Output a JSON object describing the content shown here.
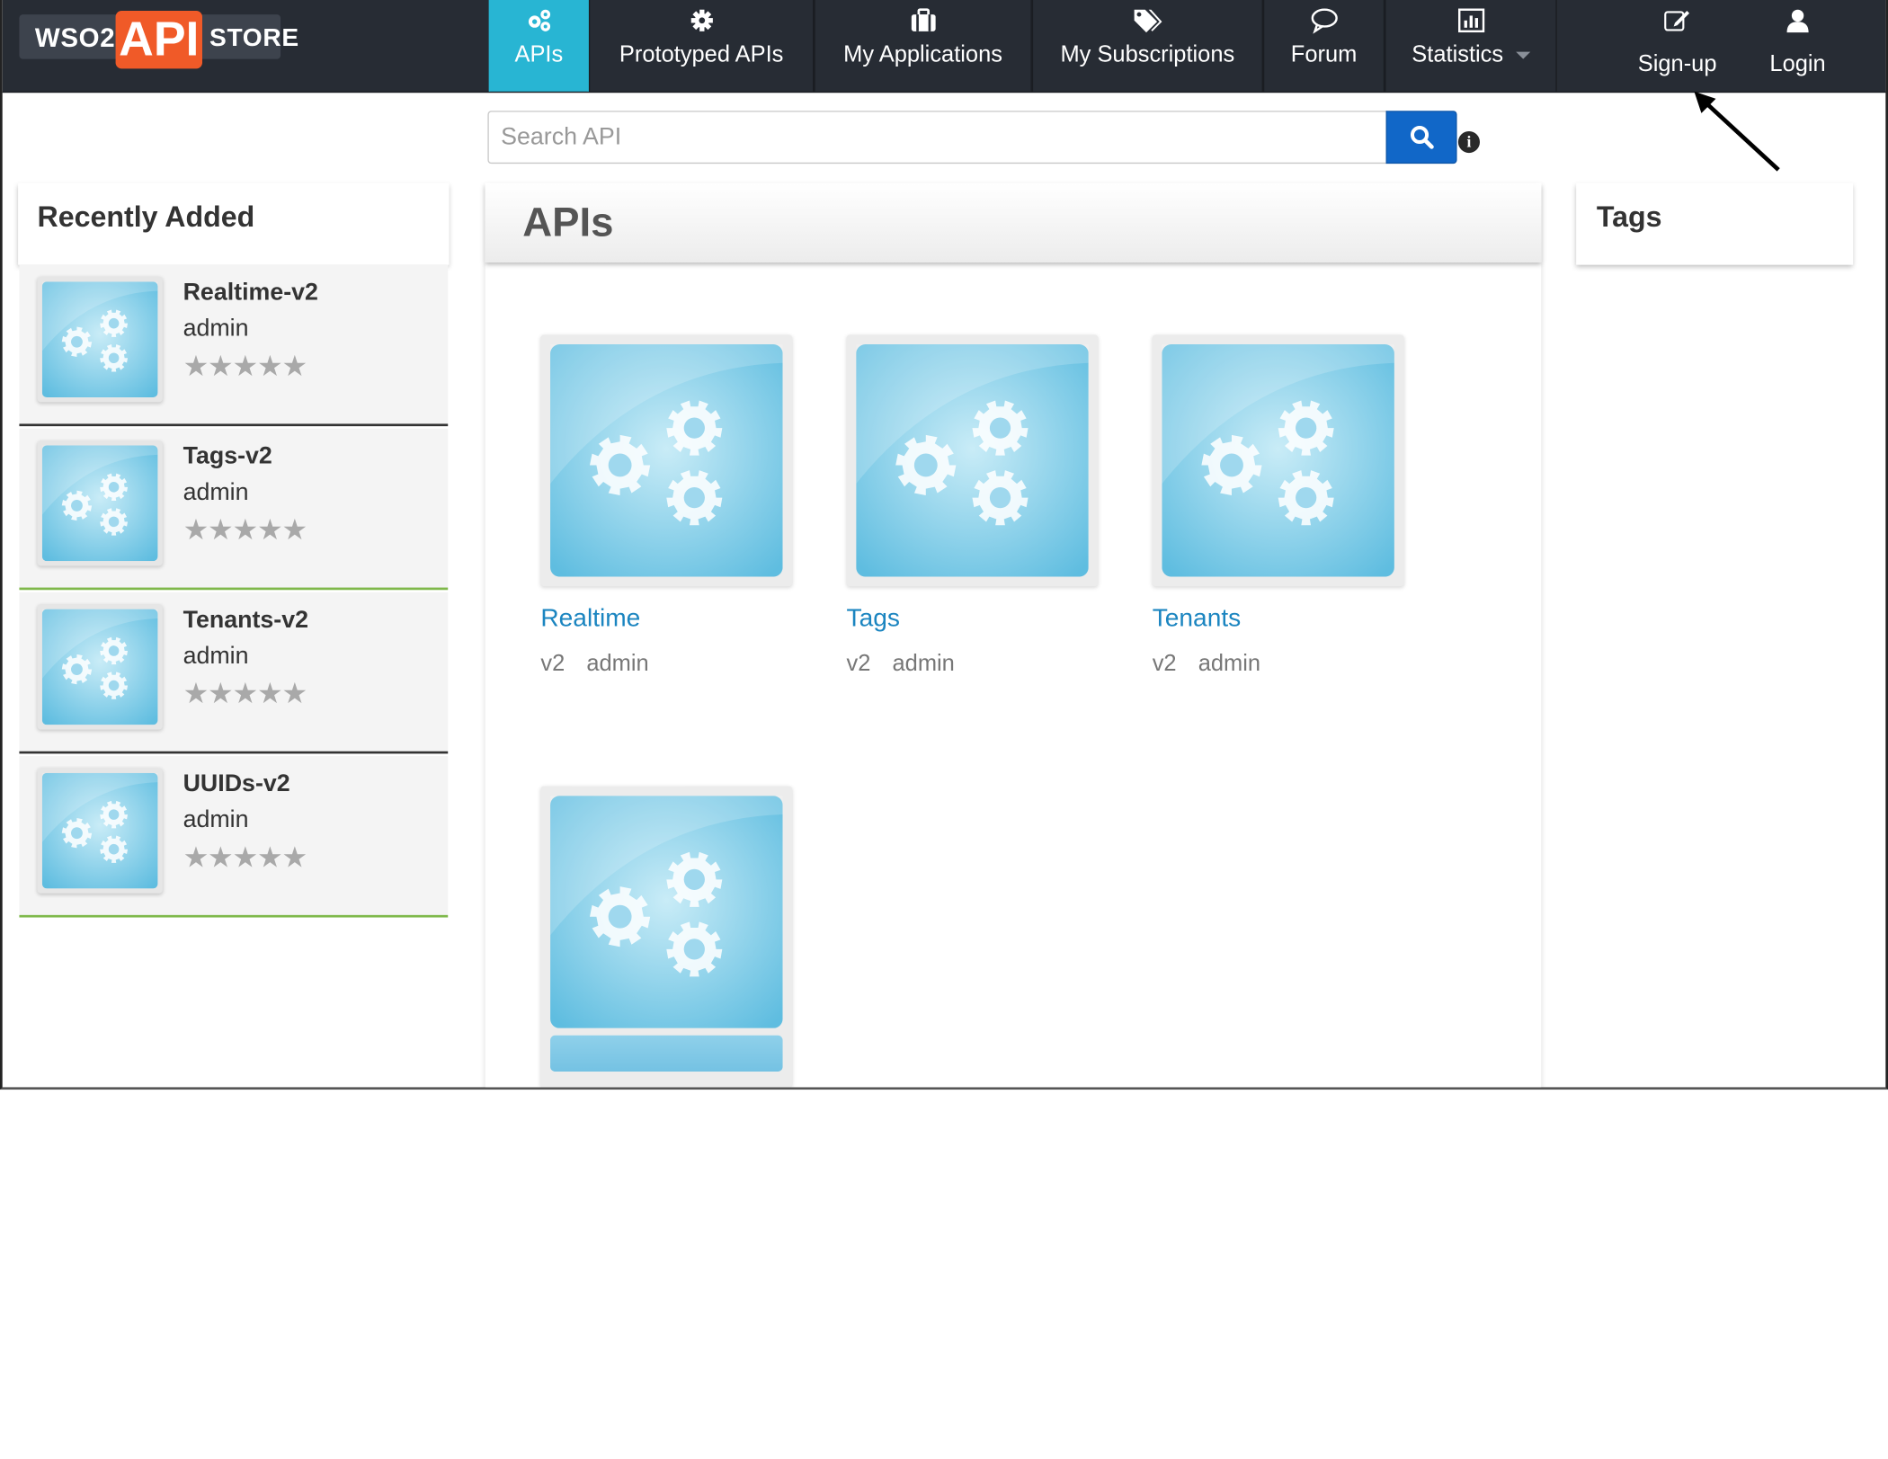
{
  "brand": {
    "wso2": "WSO2",
    "api": "API",
    "store": "STORE"
  },
  "nav": {
    "items": [
      {
        "label": "APIs",
        "icon": "cogs-icon",
        "active": true
      },
      {
        "label": "Prototyped APIs",
        "icon": "gear-icon"
      },
      {
        "label": "My Applications",
        "icon": "briefcase-icon"
      },
      {
        "label": "My Subscriptions",
        "icon": "tags-icon"
      },
      {
        "label": "Forum",
        "icon": "speech-bubble-icon"
      },
      {
        "label": "Statistics",
        "icon": "bar-chart-icon",
        "has_dropdown": true
      }
    ],
    "signup": {
      "label": "Sign-up",
      "icon": "edit-icon"
    },
    "login": {
      "label": "Login",
      "icon": "user-icon"
    }
  },
  "search": {
    "placeholder": "Search API",
    "button_icon": "search-icon",
    "info_icon": "info-icon"
  },
  "recently_added": {
    "title": "Recently Added",
    "items": [
      {
        "name": "Realtime-v2",
        "owner": "admin",
        "rating": 0,
        "stars": "★★★★★"
      },
      {
        "name": "Tags-v2",
        "owner": "admin",
        "rating": 0,
        "stars": "★★★★★"
      },
      {
        "name": "Tenants-v2",
        "owner": "admin",
        "rating": 0,
        "stars": "★★★★★"
      },
      {
        "name": "UUIDs-v2",
        "owner": "admin",
        "rating": 0,
        "stars": "★★★★★"
      }
    ]
  },
  "apis": {
    "title": "APIs",
    "cards": [
      {
        "name": "Realtime",
        "version": "v2",
        "owner": "admin"
      },
      {
        "name": "Tags",
        "version": "v2",
        "owner": "admin"
      },
      {
        "name": "Tenants",
        "version": "v2",
        "owner": "admin"
      },
      {
        "name": "",
        "version": "",
        "owner": ""
      }
    ]
  },
  "tags": {
    "title": "Tags"
  },
  "colors": {
    "navbar": "#272c34",
    "active_tab": "#28b5d3",
    "brand_orange": "#f05a28",
    "search_button": "#1167c8",
    "link": "#1b85c0"
  }
}
